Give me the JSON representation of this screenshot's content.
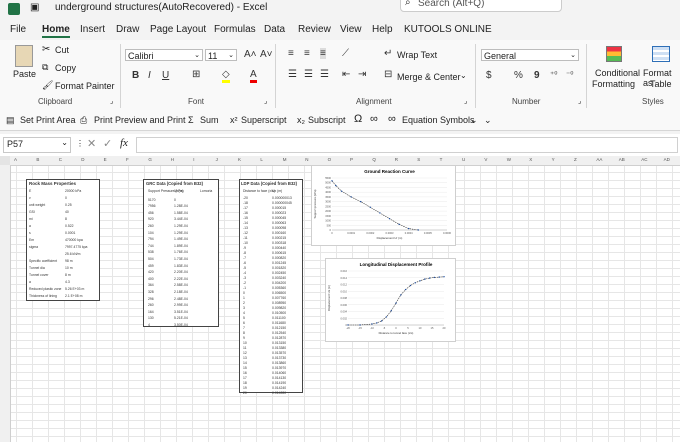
{
  "window": {
    "title": "underground structures(AutoRecovered)  -  Excel",
    "search_placeholder": "Search (Alt+Q)"
  },
  "menu": [
    "File",
    "Home",
    "Insert",
    "Draw",
    "Page Layout",
    "Formulas",
    "Data",
    "Review",
    "View",
    "Help",
    "KUTOOLS ONLINE"
  ],
  "ribbon": {
    "paste": "Paste",
    "cut": "Cut",
    "copy": "Copy",
    "format_painter": "Format Painter",
    "clipboard": "Clipboard",
    "font_name": "Calibri",
    "font_size": "11",
    "font": "Font",
    "wrap_text": "Wrap Text",
    "merge_center": "Merge & Center",
    "alignment": "Alignment",
    "number_format": "General",
    "number": "Number",
    "cond_fmt_1": "Conditional",
    "cond_fmt_2": "Formatting",
    "fmt_table_1": "Format as",
    "fmt_table_2": "Table",
    "styles": "Styles"
  },
  "quick_toolbar": [
    "Set Print Area",
    "Print Preview and Print",
    "Sum",
    "Superscript",
    "Subscript",
    "Equation Symbols"
  ],
  "formula_bar": {
    "name_box": "P57",
    "fx": "fx",
    "value": ""
  },
  "columns": [
    "A",
    "B",
    "C",
    "D",
    "E",
    "F",
    "G",
    "H",
    "I",
    "J",
    "K",
    "L",
    "M",
    "N",
    "O",
    "P",
    "Q",
    "R",
    "S",
    "T",
    "U",
    "V",
    "W",
    "X",
    "Y",
    "Z",
    "AA",
    "AB",
    "AC",
    "AD"
  ],
  "tables": {
    "rock": {
      "title": "Rock Mass Properties",
      "rows": [
        [
          "E",
          "20000 kPa"
        ],
        [
          "v",
          "0"
        ],
        [
          "unit weight",
          "0.25"
        ],
        [
          "GSI",
          "40"
        ],
        [
          "mi",
          "8"
        ],
        [
          "a",
          "0.522"
        ],
        [
          "s",
          "0.0001"
        ],
        [
          "Em",
          "470000 kpa"
        ],
        [
          "sigma",
          "7997.4775 kpa"
        ],
        [
          "",
          "25.6 kN/m"
        ],
        [
          "Specific coefficient",
          "98 m"
        ],
        [
          "Tunnel dia",
          "10 m"
        ],
        [
          "Tunnel cover",
          "8 m"
        ],
        [
          "a",
          "4.3"
        ],
        [
          "Reduced plastic zone",
          "5.26 E+03 m"
        ],
        [
          "Thickness of lining",
          "2.1 E+08 m"
        ]
      ]
    },
    "grc": {
      "title": "GRC Data (Copied from B32)",
      "headers": [
        "Support Pressure (kPa)",
        "Ur (m)",
        "Lomoria"
      ],
      "rows": [
        [
          "5170",
          "0"
        ],
        [
          "7956",
          "1.28E-04"
        ],
        [
          "456",
          "1.58E-04"
        ],
        [
          "920",
          "3.44E-04"
        ],
        [
          "260",
          "1.29E-04"
        ],
        [
          "104",
          "1.29E-04"
        ],
        [
          "794",
          "1.49E-04"
        ],
        [
          "744",
          "1.89E-04"
        ],
        [
          "538",
          "1.76E-04"
        ],
        [
          "504",
          "1.73E-04"
        ],
        [
          "459",
          "1.83E-04"
        ],
        [
          "420",
          "2.20E-04"
        ],
        [
          "400",
          "2.22E-04"
        ],
        [
          "364",
          "2.58E-04"
        ],
        [
          "328",
          "2.18E-04"
        ],
        [
          "296",
          "2.48E-04"
        ],
        [
          "260",
          "2.99E-04"
        ],
        [
          "164",
          "3.51E-04"
        ],
        [
          "130",
          "5.21E-04"
        ],
        [
          "4",
          "3.50E-04"
        ]
      ]
    },
    "ldp": {
      "title": "LDP Data (Copied from B32)",
      "headers": [
        "Distance to face (x/s)",
        "Ux (m)"
      ],
      "rows": [
        [
          "-20",
          "0.000000013"
        ],
        [
          "-18",
          "0.000000045"
        ],
        [
          "-17",
          "0.000015"
        ],
        [
          "-16",
          "0.000023"
        ],
        [
          "-15",
          "0.000045"
        ],
        [
          "-14",
          "0.000063"
        ],
        [
          "-13",
          "0.000098"
        ],
        [
          "-12",
          "0.000160"
        ],
        [
          "-11",
          "0.000215"
        ],
        [
          "-10",
          "0.000318"
        ],
        [
          "-9",
          "0.000440"
        ],
        [
          "-8",
          "0.000615"
        ],
        [
          "-7",
          "0.000820"
        ],
        [
          "-6",
          "0.001245"
        ],
        [
          "-5",
          "0.001820"
        ],
        [
          "-4",
          "0.002450"
        ],
        [
          "-3",
          "0.003240"
        ],
        [
          "-2",
          "0.004200"
        ],
        [
          "-1",
          "0.005360"
        ],
        [
          "0",
          "0.006500"
        ],
        [
          "1",
          "0.007760"
        ],
        [
          "2",
          "0.008950"
        ],
        [
          "3",
          "0.009820"
        ],
        [
          "4",
          "0.010500"
        ],
        [
          "5",
          "0.011100"
        ],
        [
          "6",
          "0.011680"
        ],
        [
          "7",
          "0.012150"
        ],
        [
          "8",
          "0.012540"
        ],
        [
          "9",
          "0.012870"
        ],
        [
          "10",
          "0.013150"
        ],
        [
          "11",
          "0.013380"
        ],
        [
          "12",
          "0.013570"
        ],
        [
          "13",
          "0.013730"
        ],
        [
          "14",
          "0.013860"
        ],
        [
          "15",
          "0.013970"
        ],
        [
          "16",
          "0.014060"
        ],
        [
          "17",
          "0.014130"
        ],
        [
          "18",
          "0.014190"
        ],
        [
          "19",
          "0.014240"
        ],
        [
          "20",
          "0.014280"
        ]
      ]
    }
  },
  "chart_data": [
    {
      "type": "line",
      "title": "Ground Reaction Curve",
      "xlabel": "Displacement Ur (m)",
      "ylabel": "Support pressure (kPa)",
      "x": [
        0,
        2e-05,
        5e-05,
        0.0001,
        0.00015,
        0.0002,
        0.00025,
        0.0003,
        0.00035,
        0.0004,
        0.00045
      ],
      "y": [
        5200,
        4700,
        4100,
        3500,
        3000,
        2400,
        1800,
        1200,
        600,
        150,
        0
      ],
      "xlim": [
        0,
        0.0006
      ],
      "ylim": [
        0,
        5500
      ],
      "xticks": [
        "0",
        "0.0001",
        "0.0002",
        "0.0003",
        "0.0004",
        "0.0005",
        "0.0006"
      ],
      "yticks": [
        "0",
        "500",
        "1000",
        "1500",
        "2000",
        "2500",
        "3000",
        "3500",
        "4000",
        "4500",
        "5000",
        "5500"
      ]
    },
    {
      "type": "line",
      "title": "Longitudinal Displacement Profile",
      "xlabel": "Distance to tunnel face (x/s)",
      "ylabel": "Displacement Ux (m)",
      "x": [
        -20,
        -15,
        -10,
        -8,
        -6,
        -4,
        -2,
        0,
        2,
        4,
        6,
        8,
        10,
        12,
        14,
        16,
        18,
        20
      ],
      "y": [
        0.0,
        0.0,
        0.0003,
        0.0006,
        0.0012,
        0.0024,
        0.0042,
        0.0065,
        0.0089,
        0.0105,
        0.0117,
        0.0125,
        0.0131,
        0.0136,
        0.0139,
        0.0141,
        0.0142,
        0.0143
      ],
      "xlim": [
        -20,
        20
      ],
      "ylim": [
        0,
        0.016
      ],
      "xticks": [
        "-20",
        "-15",
        "-10",
        "-5",
        "0",
        "5",
        "10",
        "15",
        "20"
      ],
      "yticks": [
        "0",
        "0.002",
        "0.004",
        "0.006",
        "0.008",
        "0.010",
        "0.012",
        "0.014",
        "0.016"
      ]
    }
  ],
  "colors": {
    "accent": "#217346",
    "grid": "#e6e6e6"
  }
}
